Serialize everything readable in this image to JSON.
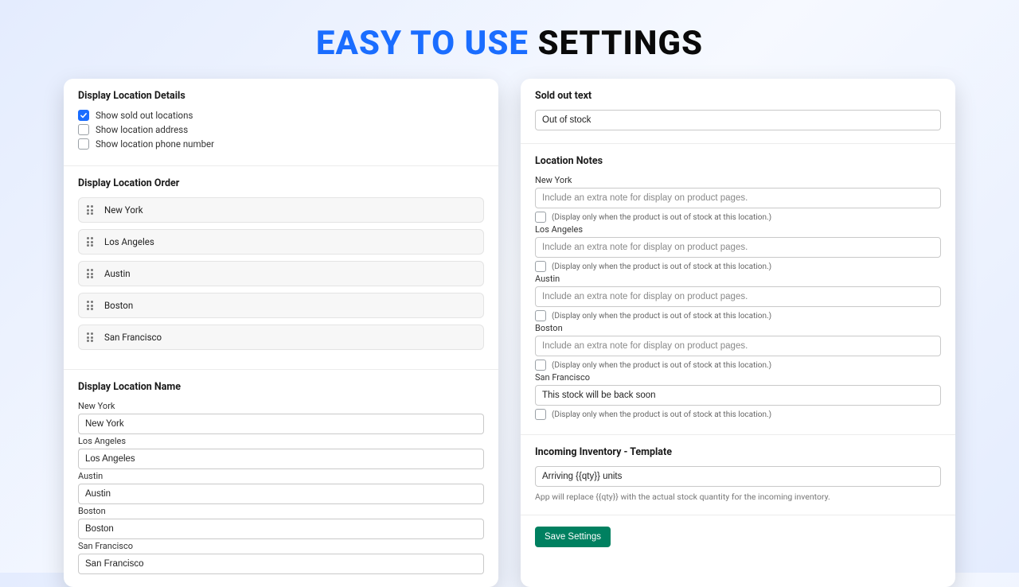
{
  "header": {
    "line1": "EASY TO USE",
    "line2": "SETTINGS"
  },
  "left": {
    "details": {
      "title": "Display Location Details",
      "opts": [
        {
          "label": "Show sold out locations",
          "checked": true
        },
        {
          "label": "Show location address",
          "checked": false
        },
        {
          "label": "Show location phone number",
          "checked": false
        }
      ]
    },
    "order": {
      "title": "Display Location Order",
      "items": [
        "New York",
        "Los Angeles",
        "Austin",
        "Boston",
        "San Francisco"
      ]
    },
    "names": {
      "title": "Display Location Name",
      "rows": [
        {
          "label": "New York",
          "value": "New York"
        },
        {
          "label": "Los Angeles",
          "value": "Los Angeles"
        },
        {
          "label": "Austin",
          "value": "Austin"
        },
        {
          "label": "Boston",
          "value": "Boston"
        },
        {
          "label": "San Francisco",
          "value": "San Francisco"
        }
      ]
    }
  },
  "right": {
    "soldout": {
      "title": "Sold out text",
      "value": "Out of stock"
    },
    "notes": {
      "title": "Location Notes",
      "placeholder": "Include an extra note for display on product pages.",
      "chk_label": "(Display only when the product is out of stock at this location.)",
      "rows": [
        {
          "label": "New York",
          "value": ""
        },
        {
          "label": "Los Angeles",
          "value": ""
        },
        {
          "label": "Austin",
          "value": ""
        },
        {
          "label": "Boston",
          "value": ""
        },
        {
          "label": "San Francisco",
          "value": "This stock will be back soon"
        }
      ]
    },
    "incoming": {
      "title": "Incoming Inventory - Template",
      "value": "Arriving {{qty}} units",
      "helper": "App will replace {{qty}} with the actual stock quantity for the incoming inventory."
    },
    "save": "Save Settings"
  }
}
